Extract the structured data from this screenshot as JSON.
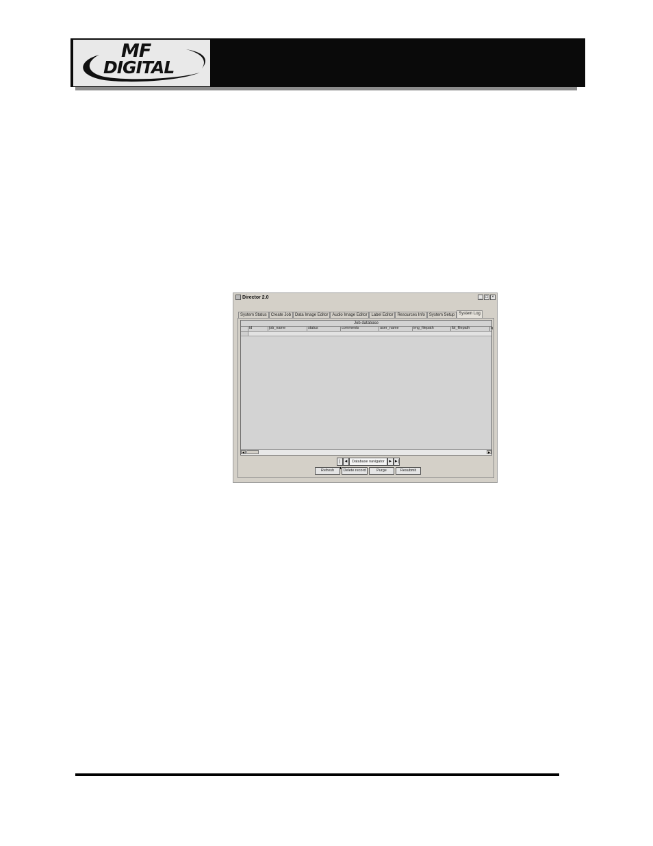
{
  "logo": {
    "line1": "MF",
    "line2": "DIGITAL",
    "colors": {
      "banner": "#0a0a0a",
      "logo_background": "#e9e9e9",
      "logo_ink": "#101010",
      "shadow": "#8c8c8c"
    }
  },
  "window": {
    "title": "Director 2.0",
    "controls": {
      "minimize": "_",
      "maximize": "□",
      "close": "×"
    },
    "tabs": [
      {
        "label": "System Status",
        "active": false
      },
      {
        "label": "Create Job",
        "active": false
      },
      {
        "label": "Data Image Editor",
        "active": false
      },
      {
        "label": "Audio Image Editor",
        "active": false
      },
      {
        "label": "Label Editor",
        "active": false
      },
      {
        "label": "Resources Info",
        "active": false
      },
      {
        "label": "System Setup",
        "active": false
      },
      {
        "label": "System Log",
        "active": true
      }
    ],
    "grid": {
      "caption": "Job database",
      "columns": [
        "id",
        "job_name",
        "status",
        "comments",
        "user_name",
        "img_filepath",
        "lbl_filepath",
        "q"
      ],
      "scroll_left_icon": "◄",
      "scroll_right_icon": "►"
    },
    "navigator": {
      "first_icon": "|◄",
      "prev_icon": "◄",
      "label": "Database navigator",
      "next_icon": "►",
      "last_icon": "►|"
    },
    "actions": {
      "refresh": "Refresh",
      "delete_record": "Delete record",
      "purge": "Purge",
      "resubmit": "Resubmit"
    }
  }
}
